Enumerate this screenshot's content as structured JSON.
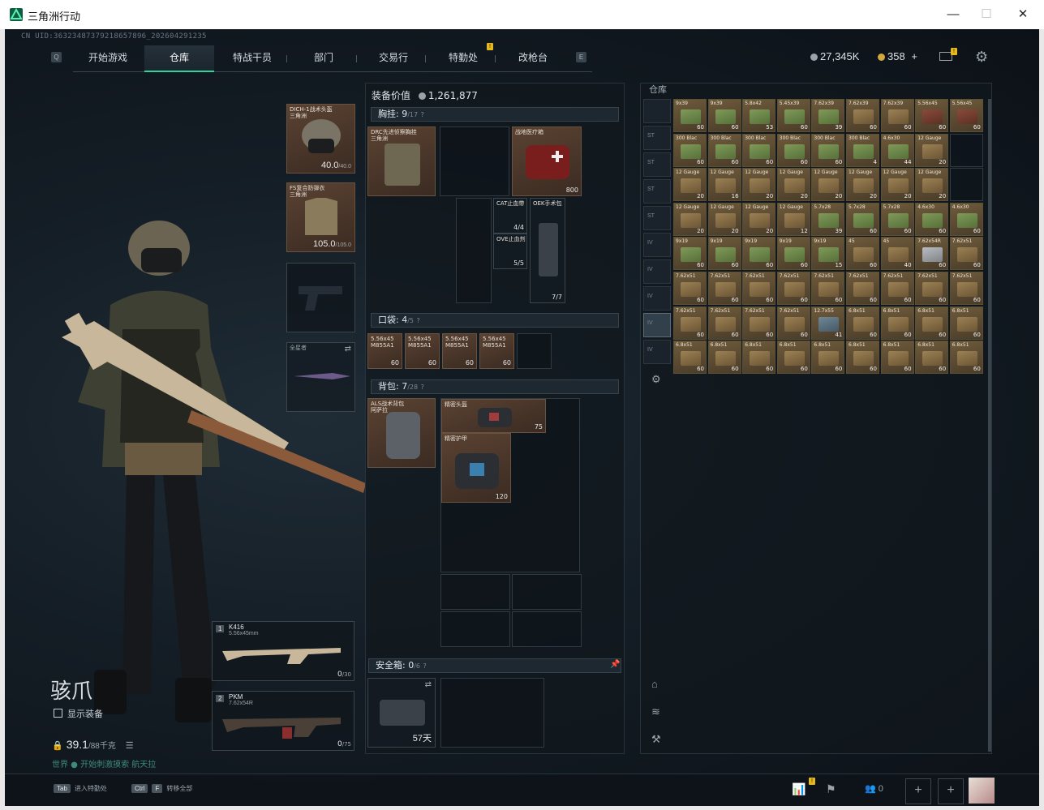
{
  "window": {
    "title": "三角洲行动",
    "minimize": "—",
    "maximize": "☐",
    "close": "✕"
  },
  "uid": "CN UID:36323487379218657896_202604291235",
  "nav": {
    "key_left": "Q",
    "key_right": "E",
    "tabs": [
      "开始游戏",
      "仓库",
      "特战干员",
      "部门",
      "交易行",
      "特勤处",
      "改枪台"
    ],
    "active_tab": "仓库",
    "badge": "!"
  },
  "currency": {
    "silver": "27,345K",
    "gold": "358",
    "plus": "+",
    "mail_badge": "!"
  },
  "colors": {
    "accent": "#32d29a",
    "badge": "#e6b81c",
    "ammo_green": "#6f9a4a",
    "ammo_tan": "#b89a5c"
  },
  "character": {
    "name": "骇爪",
    "show_equipment": "显示装备",
    "weight": "39.1",
    "weight_max": "/88千克",
    "chat": "世界 ● 开始刺激摸索 航天拉"
  },
  "gear": {
    "helmet": {
      "label": "DICH-1战术头盔\n三角洲",
      "value": "40.0",
      "max": "/40.0"
    },
    "armor": {
      "label": "FS复合防弹衣\n三角洲",
      "value": "105.0",
      "max": "/105.0"
    },
    "melee": {
      "label": "全星者"
    }
  },
  "loadout": {
    "equip_value_label": "装备价值",
    "equip_value": "1,261,877",
    "chest_rig": {
      "title": "胸挂:",
      "count": "9",
      "max": "/17",
      "help": "?"
    },
    "rig_item": "DRC先进侦察胸挂\n三角洲",
    "medkit": {
      "label": "战地医疗箱",
      "value": "800"
    },
    "cat": {
      "label": "CAT止血带",
      "value": "4/4"
    },
    "ove": {
      "label": "OVE止血剂",
      "value": "5/5"
    },
    "oek": {
      "label": "OEK手术包",
      "value": "7/7"
    },
    "pocket": {
      "title": "口袋:",
      "count": "4",
      "max": "/5",
      "help": "?"
    },
    "pocket_items": [
      {
        "label": "5.56x45\nM855A1",
        "value": "60"
      },
      {
        "label": "5.56x45\nM855A1",
        "value": "60"
      },
      {
        "label": "5.56x45\nM855A1",
        "value": "60"
      },
      {
        "label": "5.56x45\nM855A1",
        "value": "60"
      }
    ],
    "backpack": {
      "title": "背包:",
      "count": "7",
      "max": "/28",
      "help": "?"
    },
    "backpack_item": "ALS战术背包\n阿萨拉",
    "helmet_bag": {
      "label": "精密头盔",
      "value": "75"
    },
    "armor_bag": {
      "label": "精密护甲",
      "value": "120"
    },
    "safebox": {
      "title": "安全箱:",
      "count": "0",
      "max": "/6",
      "help": "?",
      "days": "57天"
    }
  },
  "weapons": [
    {
      "slot": "1",
      "name": "K416",
      "ammo_type": "5.56x45mm",
      "ammo": "0",
      "ammo_max": "/30"
    },
    {
      "slot": "2",
      "name": "PKM",
      "ammo_type": "7.62x54R",
      "ammo": "0",
      "ammo_max": "/75"
    }
  ],
  "warehouse": {
    "title": "仓库",
    "side_tabs": [
      "",
      "ST",
      "ST",
      "ST",
      "ST",
      "IV",
      "IV",
      "IV",
      "IV",
      "IV"
    ],
    "rows": [
      [
        [
          "9x39",
          "60",
          "g"
        ],
        [
          "9x39",
          "60",
          "g"
        ],
        [
          "5.8x42",
          "53",
          "g"
        ],
        [
          "5.45x39",
          "60",
          "g"
        ],
        [
          "7.62x39",
          "39",
          "g"
        ],
        [
          "7.62x39",
          "60",
          "t"
        ],
        [
          "7.62x39",
          "60",
          "t"
        ],
        [
          "5.56x45",
          "60",
          "r"
        ],
        [
          "5.56x45",
          "60",
          "r"
        ]
      ],
      [
        [
          "300 Blac",
          "60",
          "g"
        ],
        [
          "300 Blac",
          "60",
          "g"
        ],
        [
          "300 Blac",
          "60",
          "g"
        ],
        [
          "300 Blac",
          "60",
          "g"
        ],
        [
          "300 Blac",
          "60",
          "g"
        ],
        [
          "300 Blac",
          "4",
          "g"
        ],
        [
          "4.6x30",
          "44",
          "g"
        ],
        [
          "12 Gauge",
          "20",
          "t"
        ],
        [
          "",
          ""
        ]
      ],
      [
        [
          "12 Gauge",
          "20",
          "t"
        ],
        [
          "12 Gauge",
          "16",
          "t"
        ],
        [
          "12 Gauge",
          "20",
          "t"
        ],
        [
          "12 Gauge",
          "20",
          "t"
        ],
        [
          "12 Gauge",
          "20",
          "t"
        ],
        [
          "12 Gauge",
          "20",
          "t"
        ],
        [
          "12 Gauge",
          "20",
          "t"
        ],
        [
          "12 Gauge",
          "20",
          "t"
        ],
        [
          "",
          ""
        ]
      ],
      [
        [
          "12 Gauge",
          "20",
          "t"
        ],
        [
          "12 Gauge",
          "20",
          "t"
        ],
        [
          "12 Gauge",
          "20",
          "t"
        ],
        [
          "12 Gauge",
          "12",
          "t"
        ],
        [
          "5.7x28",
          "39",
          "g"
        ],
        [
          "5.7x28",
          "60",
          "g"
        ],
        [
          "5.7x28",
          "60",
          "g"
        ],
        [
          "4.6x30",
          "60",
          "g"
        ],
        [
          "4.6x30",
          "60",
          "g"
        ]
      ],
      [
        [
          "9x19",
          "60",
          "g"
        ],
        [
          "9x19",
          "60",
          "g"
        ],
        [
          "9x19",
          "60",
          "g"
        ],
        [
          "9x19",
          "60",
          "g"
        ],
        [
          "9x19",
          "15",
          "g"
        ],
        [
          "45",
          "60",
          "t"
        ],
        [
          "45",
          "40",
          "t"
        ],
        [
          "7.62x54R",
          "60",
          "w"
        ],
        [
          "7.62x51",
          "60",
          "t"
        ]
      ],
      [
        [
          "7.62x51",
          "60",
          "t"
        ],
        [
          "7.62x51",
          "60",
          "t"
        ],
        [
          "7.62x51",
          "60",
          "t"
        ],
        [
          "7.62x51",
          "60",
          "t"
        ],
        [
          "7.62x51",
          "60",
          "t"
        ],
        [
          "7.62x51",
          "60",
          "t"
        ],
        [
          "7.62x51",
          "60",
          "t"
        ],
        [
          "7.62x51",
          "60",
          "t"
        ],
        [
          "7.62x51",
          "60",
          "t"
        ]
      ],
      [
        [
          "7.62x51",
          "60",
          "t"
        ],
        [
          "7.62x51",
          "60",
          "t"
        ],
        [
          "7.62x51",
          "60",
          "t"
        ],
        [
          "7.62x51",
          "60",
          "t"
        ],
        [
          "12.7x55",
          "41",
          "b"
        ],
        [
          "6.8x51",
          "60",
          "t"
        ],
        [
          "6.8x51",
          "60",
          "t"
        ],
        [
          "6.8x51",
          "60",
          "t"
        ],
        [
          "6.8x51",
          "60",
          "t"
        ]
      ],
      [
        [
          "6.8x51",
          "60",
          "t"
        ],
        [
          "6.8x51",
          "60",
          "t"
        ],
        [
          "6.8x51",
          "60",
          "t"
        ],
        [
          "6.8x51",
          "60",
          "t"
        ],
        [
          "6.8x51",
          "60",
          "t"
        ],
        [
          "6.8x51",
          "60",
          "t"
        ],
        [
          "6.8x51",
          "60",
          "t"
        ],
        [
          "6.8x51",
          "60",
          "t"
        ],
        [
          "6.8x51",
          "60",
          "t"
        ]
      ]
    ]
  },
  "bottom": {
    "tab_key": "Tab",
    "tab_text": "进入特勤处",
    "ctrl_key": "Ctrl",
    "f_key": "F",
    "ctrl_text": "转移全部",
    "friends": "0",
    "badge": "!"
  }
}
